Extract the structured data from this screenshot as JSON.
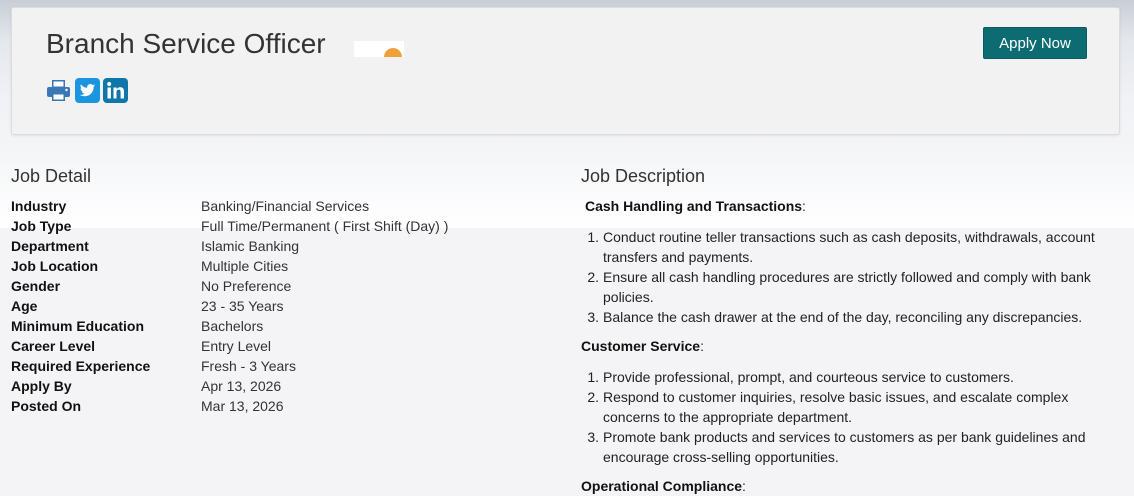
{
  "header": {
    "title": "Branch Service Officer",
    "apply_label": "Apply Now",
    "share_icons": [
      "print-icon",
      "twitter-icon",
      "linkedin-icon"
    ]
  },
  "colors": {
    "apply_button": "#0d6b72",
    "twitter": "#1b95e0",
    "linkedin": "#0e76a8",
    "print": "#3a78b5"
  },
  "job_detail": {
    "heading": "Job Detail",
    "rows": [
      {
        "label": "Industry",
        "value": "Banking/Financial Services"
      },
      {
        "label": "Job Type",
        "value": "Full Time/Permanent ( First Shift (Day) )"
      },
      {
        "label": "Department",
        "value": "Islamic Banking"
      },
      {
        "label": "Job Location",
        "value": "Multiple Cities"
      },
      {
        "label": "Gender",
        "value": "No Preference"
      },
      {
        "label": "Age",
        "value": "23 - 35 Years"
      },
      {
        "label": "Minimum Education",
        "value": "Bachelors"
      },
      {
        "label": "Career Level",
        "value": "Entry Level"
      },
      {
        "label": "Required Experience",
        "value": "Fresh - 3 Years"
      },
      {
        "label": "Apply By",
        "value": "Apr 13, 2026"
      },
      {
        "label": "Posted On",
        "value": "Mar 13, 2026"
      }
    ]
  },
  "job_description": {
    "heading": "Job Description",
    "sections": [
      {
        "title": "Cash Handling and Transactions",
        "items": [
          "Conduct routine teller transactions such as cash deposits, withdrawals, account transfers and payments.",
          "Ensure all cash handling procedures are strictly followed and comply with bank policies.",
          "Balance the cash drawer at the end of the day, reconciling any discrepancies."
        ]
      },
      {
        "title": "Customer Service",
        "items": [
          "Provide professional, prompt, and courteous service to customers.",
          "Respond to customer inquiries, resolve basic issues, and escalate complex concerns to the appropriate department.",
          "Promote bank products and services to customers as per bank guidelines and encourage cross-selling opportunities."
        ]
      },
      {
        "title": "Operational Compliance",
        "items": []
      }
    ]
  }
}
